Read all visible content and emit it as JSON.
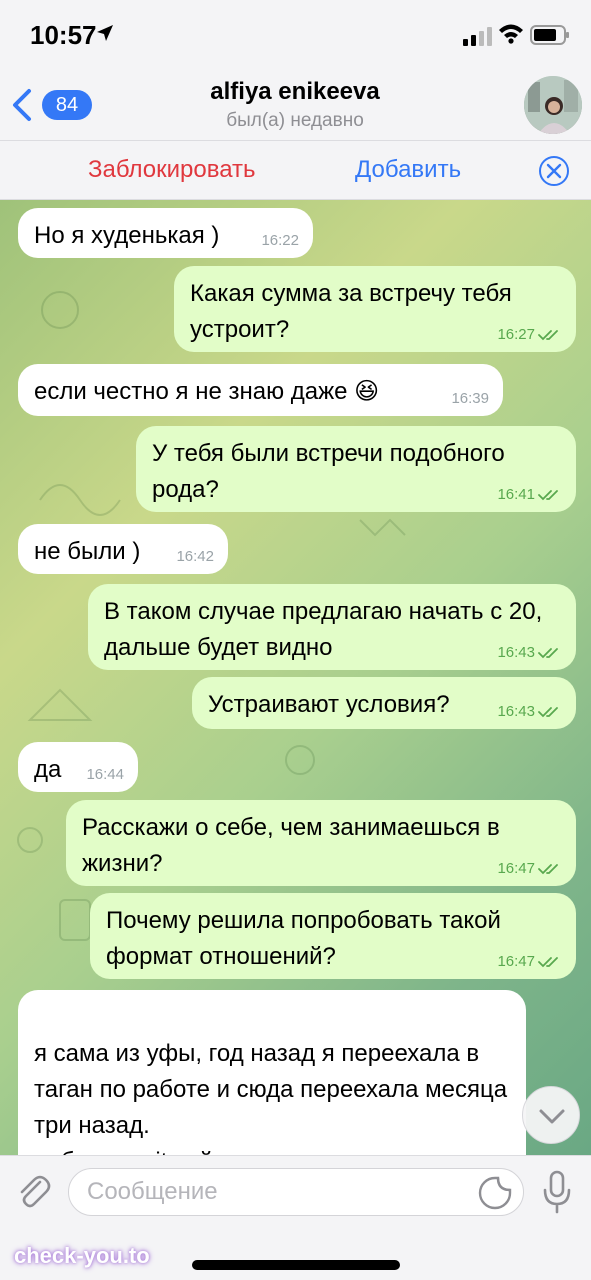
{
  "status_bar": {
    "time": "10:57"
  },
  "header": {
    "back_count": "84",
    "title": "alfiya enikeeva",
    "status": "был(а) недавно"
  },
  "actions": {
    "block_label": "Заблокировать",
    "add_label": "Добавить"
  },
  "messages": [
    {
      "dir": "in",
      "text": "Но я худенькая )",
      "time": "16:22"
    },
    {
      "dir": "out",
      "text": "Какая сумма за встречу тебя устроит?",
      "time": "16:27"
    },
    {
      "dir": "in",
      "text": "если честно я не знаю даже 😆",
      "time": "16:39"
    },
    {
      "dir": "out",
      "text": "У тебя были встречи подобного рода?",
      "time": "16:41"
    },
    {
      "dir": "in",
      "text": "не были )",
      "time": "16:42"
    },
    {
      "dir": "out",
      "text": "В таком случае предлагаю начать с 20, дальше будет видно",
      "time": "16:43"
    },
    {
      "dir": "out",
      "text": "Устраивают условия?",
      "time": "16:43"
    },
    {
      "dir": "in",
      "text": "да",
      "time": "16:44"
    },
    {
      "dir": "out",
      "text": "Расскажи о себе, чем занимаешься в жизни?",
      "time": "16:47"
    },
    {
      "dir": "out",
      "text": "Почему решила попробовать такой формат отношений?",
      "time": "16:47"
    },
    {
      "dir": "in",
      "text": "я сама из уфы, год назад я переехала в таган по работе и сюда переехала месяца три назад.\nработаю в it сейчас уже год, разработчиком удаленно",
      "time": ""
    }
  ],
  "input": {
    "placeholder": "Сообщение"
  },
  "watermark": {
    "site": "check-you.to"
  },
  "colors": {
    "accent": "#3478f6",
    "danger": "#e0383e",
    "outgoing_bubble": "#e2fdc8",
    "incoming_bubble": "#ffffff",
    "read_check": "#58a84e"
  },
  "icons": {
    "back": "chevron-left-icon",
    "close": "close-circle-icon",
    "attach": "paperclip-icon",
    "sticker": "sticker-icon",
    "mic": "microphone-icon",
    "scroll": "chevron-down-icon"
  }
}
